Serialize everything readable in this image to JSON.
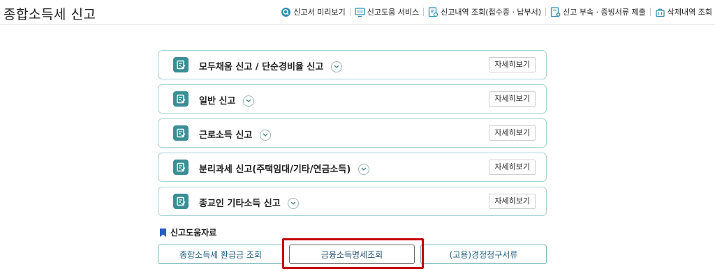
{
  "header": {
    "title": "종합소득세 신고",
    "links": [
      {
        "label": "신고서 미리보기",
        "icon": "magnifier-icon"
      },
      {
        "label": "신고도움 서비스",
        "icon": "monitor-icon"
      },
      {
        "label": "신고내역 조회(접수증 · 납부서)",
        "icon": "document-search-icon"
      },
      {
        "label": "신고 부속 · 증빙서류 제출",
        "icon": "document-upload-icon"
      },
      {
        "label": "삭제내역 조회",
        "icon": "trash-icon"
      }
    ]
  },
  "cards": [
    {
      "title": "모두채움 신고 / 단순경비율 신고",
      "button": "자세히보기"
    },
    {
      "title": "일반 신고",
      "button": "자세히보기"
    },
    {
      "title": "근로소득 신고",
      "button": "자세히보기"
    },
    {
      "title": "분리과세 신고(주택임대/기타/연금소득)",
      "button": "자세히보기"
    },
    {
      "title": "종교인 기타소득 신고",
      "button": "자세히보기"
    }
  ],
  "help": {
    "heading": "신고도움자료",
    "buttons": [
      "종합소득세 환급금 조회",
      "금융소득명세조회",
      "(고용)경정청구서류"
    ]
  },
  "colors": {
    "accent": "#3a8f95",
    "card_border": "#a7d3d4",
    "highlight": "#c40000",
    "bookmark": "#2b5fb8"
  }
}
